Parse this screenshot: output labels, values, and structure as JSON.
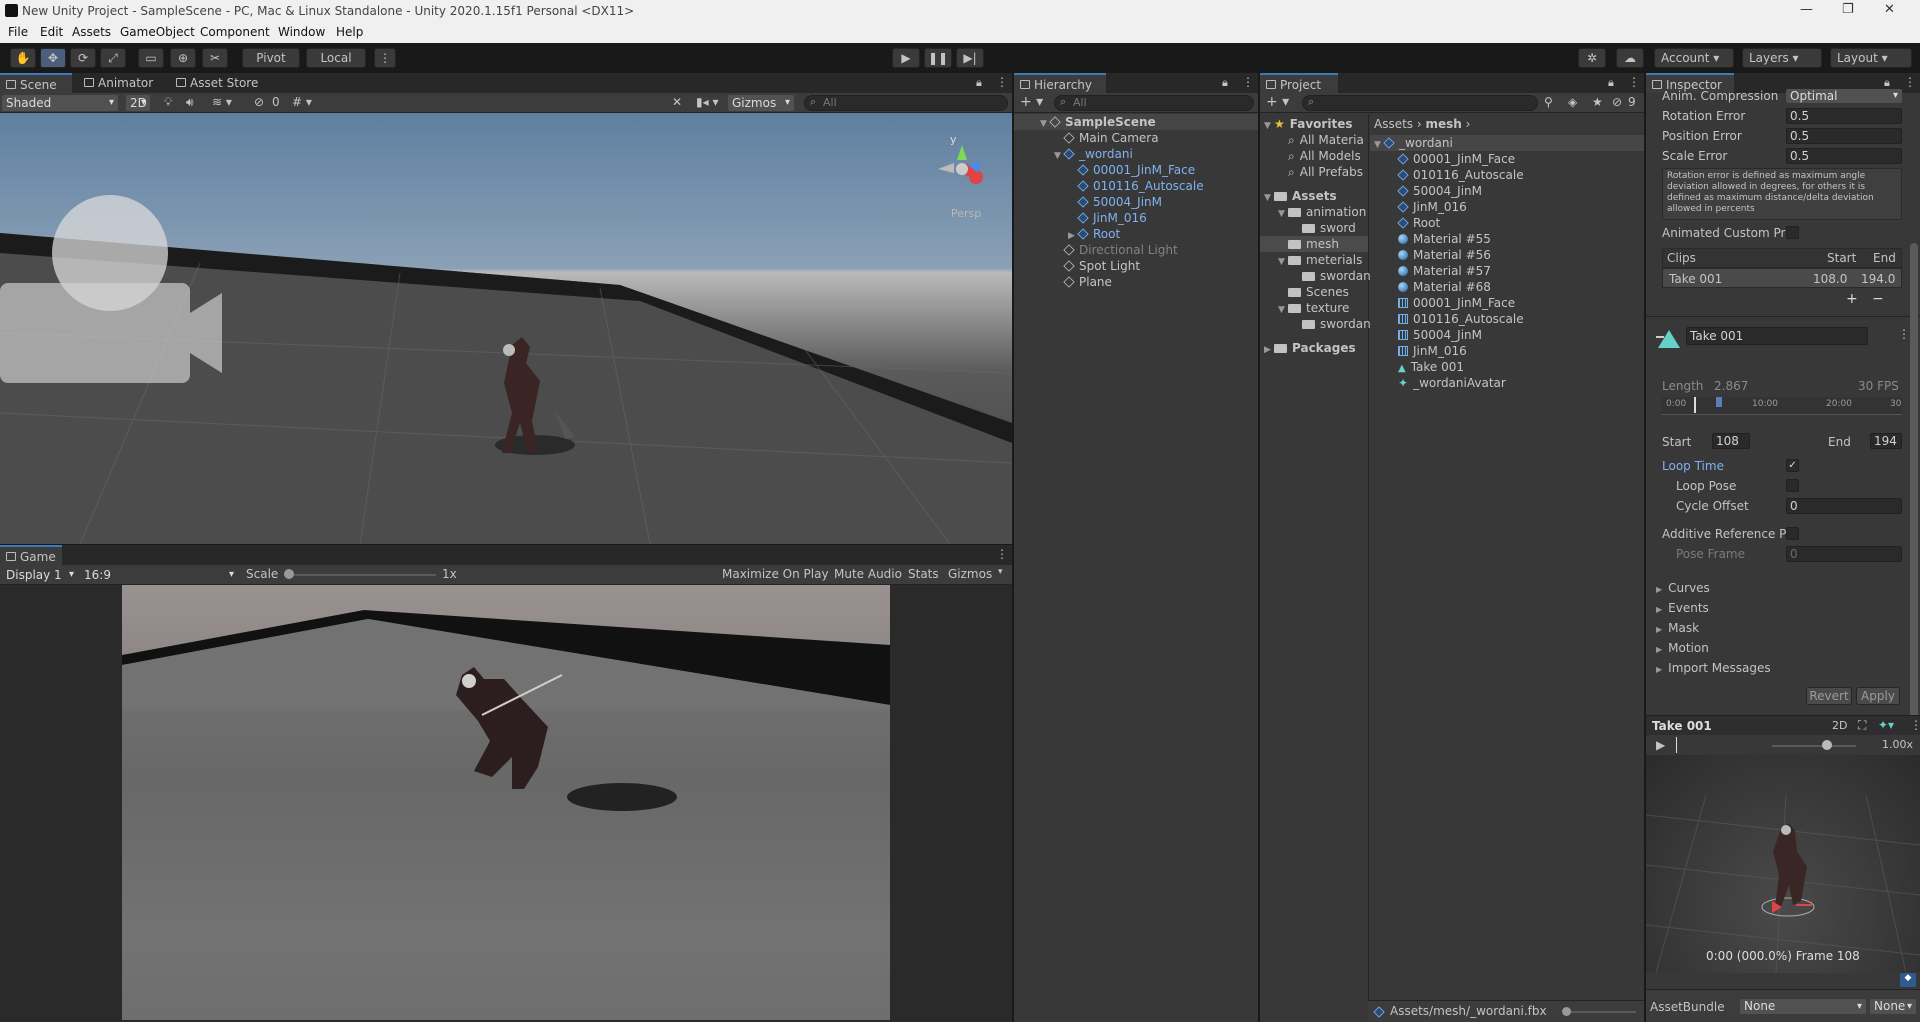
{
  "window": {
    "title": "New Unity Project - SampleScene - PC, Mac & Linux Standalone - Unity 2020.1.15f1 Personal <DX11>"
  },
  "menu": [
    "File",
    "Edit",
    "Assets",
    "GameObject",
    "Component",
    "Window",
    "Help"
  ],
  "toolbar": {
    "pivot": "Pivot",
    "local": "Local",
    "account": "Account",
    "layers": "Layers",
    "layout": "Layout"
  },
  "scene": {
    "tabs": [
      "Scene",
      "Animator",
      "Asset Store"
    ],
    "shading": "Shaded",
    "mode_2d": "2D",
    "hidden_count": "0",
    "gizmos": "Gizmos",
    "search_placeholder": "All",
    "persp": "Persp",
    "axis_y": "y"
  },
  "game": {
    "tab": "Game",
    "display": "Display 1",
    "aspect": "16:9",
    "scale_label": "Scale",
    "scale_value": "1x",
    "scale_fraction": 0.0,
    "buttons": [
      "Maximize On Play",
      "Mute Audio",
      "Stats",
      "Gizmos"
    ]
  },
  "hierarchy": {
    "tab": "Hierarchy",
    "search_placeholder": "All",
    "items": [
      {
        "label": "SampleScene",
        "indent": 0,
        "kind": "scene",
        "style": "bold"
      },
      {
        "label": "Main Camera",
        "indent": 1,
        "kind": "cube",
        "style": ""
      },
      {
        "label": "_wordani",
        "indent": 1,
        "kind": "prefab",
        "style": "blue",
        "expanded": true
      },
      {
        "label": "00001_JinM_Face",
        "indent": 2,
        "kind": "prefab",
        "style": "blue"
      },
      {
        "label": "010116_Autoscale",
        "indent": 2,
        "kind": "prefab",
        "style": "blue"
      },
      {
        "label": "50004_JinM",
        "indent": 2,
        "kind": "prefab",
        "style": "blue"
      },
      {
        "label": "JinM_016",
        "indent": 2,
        "kind": "prefab",
        "style": "blue"
      },
      {
        "label": "Root",
        "indent": 2,
        "kind": "prefab",
        "style": "blue",
        "collapsed": true
      },
      {
        "label": "Directional Light",
        "indent": 1,
        "kind": "cube",
        "style": "dim"
      },
      {
        "label": "Spot Light",
        "indent": 1,
        "kind": "cube",
        "style": ""
      },
      {
        "label": "Plane",
        "indent": 1,
        "kind": "cube",
        "style": ""
      }
    ]
  },
  "project": {
    "tab": "Project",
    "hidden_count": "9",
    "tree": [
      {
        "label": "Favorites",
        "indent": 0,
        "kind": "star",
        "bold": true
      },
      {
        "label": "All Materia",
        "indent": 1,
        "kind": "search"
      },
      {
        "label": "All Models",
        "indent": 1,
        "kind": "search"
      },
      {
        "label": "All Prefabs",
        "indent": 1,
        "kind": "search"
      },
      {
        "label": "Assets",
        "indent": 0,
        "kind": "folder",
        "bold": true
      },
      {
        "label": "animation",
        "indent": 1,
        "kind": "folder"
      },
      {
        "label": "sword",
        "indent": 2,
        "kind": "folder"
      },
      {
        "label": "mesh",
        "indent": 1,
        "kind": "folder",
        "selected": true
      },
      {
        "label": "meterials",
        "indent": 1,
        "kind": "folder"
      },
      {
        "label": "swordan",
        "indent": 2,
        "kind": "folder"
      },
      {
        "label": "Scenes",
        "indent": 1,
        "kind": "folder"
      },
      {
        "label": "texture",
        "indent": 1,
        "kind": "folder"
      },
      {
        "label": "swordan",
        "indent": 2,
        "kind": "folder"
      },
      {
        "label": "Packages",
        "indent": 0,
        "kind": "folder",
        "bold": true
      }
    ],
    "breadcrumb": [
      "Assets",
      "mesh"
    ],
    "files": [
      {
        "label": "_wordani",
        "kind": "prefab",
        "indent": 0
      },
      {
        "label": "00001_JinM_Face",
        "kind": "mesh",
        "indent": 1
      },
      {
        "label": "010116_Autoscale",
        "kind": "mesh",
        "indent": 1
      },
      {
        "label": "50004_JinM",
        "kind": "mesh",
        "indent": 1
      },
      {
        "label": "JinM_016",
        "kind": "mesh",
        "indent": 1
      },
      {
        "label": "Root",
        "kind": "mesh",
        "indent": 1
      },
      {
        "label": "Material #55",
        "kind": "material",
        "indent": 1
      },
      {
        "label": "Material #56",
        "kind": "material",
        "indent": 1
      },
      {
        "label": "Material #57",
        "kind": "material",
        "indent": 1
      },
      {
        "label": "Material #68",
        "kind": "material",
        "indent": 1
      },
      {
        "label": "00001_JinM_Face",
        "kind": "grid",
        "indent": 1
      },
      {
        "label": "010116_Autoscale",
        "kind": "grid",
        "indent": 1
      },
      {
        "label": "50004_JinM",
        "kind": "grid",
        "indent": 1
      },
      {
        "label": "JinM_016",
        "kind": "grid",
        "indent": 1
      },
      {
        "label": "Take 001",
        "kind": "anim",
        "indent": 1
      },
      {
        "label": "_wordaniAvatar",
        "kind": "avatar",
        "indent": 1
      }
    ],
    "footer_path": "Assets/mesh/_wordani.fbx"
  },
  "inspector": {
    "tab": "Inspector",
    "anim_compression_label": "Anim. Compression",
    "anim_compression": "Optimal",
    "rotation_error_label": "Rotation Error",
    "rotation_error": "0.5",
    "position_error_label": "Position Error",
    "position_error": "0.5",
    "scale_error_label": "Scale Error",
    "scale_error": "0.5",
    "help": "Rotation error is defined as maximum angle deviation allowed in degrees, for others it is defined as maximum distance/delta deviation allowed in percents",
    "animated_custom_label": "Animated Custom Pro",
    "clips_header": "Clips",
    "clips_start": "Start",
    "clips_end": "End",
    "clip": {
      "name": "Take 001",
      "start": "108.0",
      "end": "194.0"
    },
    "clip_name_field": "Take 001",
    "length_label": "Length",
    "length_value": "2.867",
    "fps": "30 FPS",
    "timeline_ticks": [
      "0:00",
      "10:00",
      "20:00",
      "30"
    ],
    "start_label": "Start",
    "start_value": "108",
    "end_label": "End",
    "end_value": "194",
    "loop_time": "Loop Time",
    "loop_time_checked": true,
    "loop_pose": "Loop Pose",
    "cycle_offset_label": "Cycle Offset",
    "cycle_offset": "0",
    "additive_label": "Additive Reference P",
    "pose_frame_label": "Pose Frame",
    "pose_frame": "0",
    "sections": [
      "Curves",
      "Events",
      "Mask",
      "Motion",
      "Import Messages"
    ],
    "revert": "Revert",
    "apply": "Apply",
    "preview": {
      "title": "Take 001",
      "mode_2d": "2D",
      "speed": "1.00x",
      "status": "0:00 (000.0%) Frame 108"
    },
    "assetbundle_label": "AssetBundle",
    "assetbundle": "None",
    "assetbundle_variant": "None"
  },
  "colors": {
    "accent": "#3a79bb",
    "prefab": "#7fb2f0",
    "selection": "#2c5d87"
  }
}
